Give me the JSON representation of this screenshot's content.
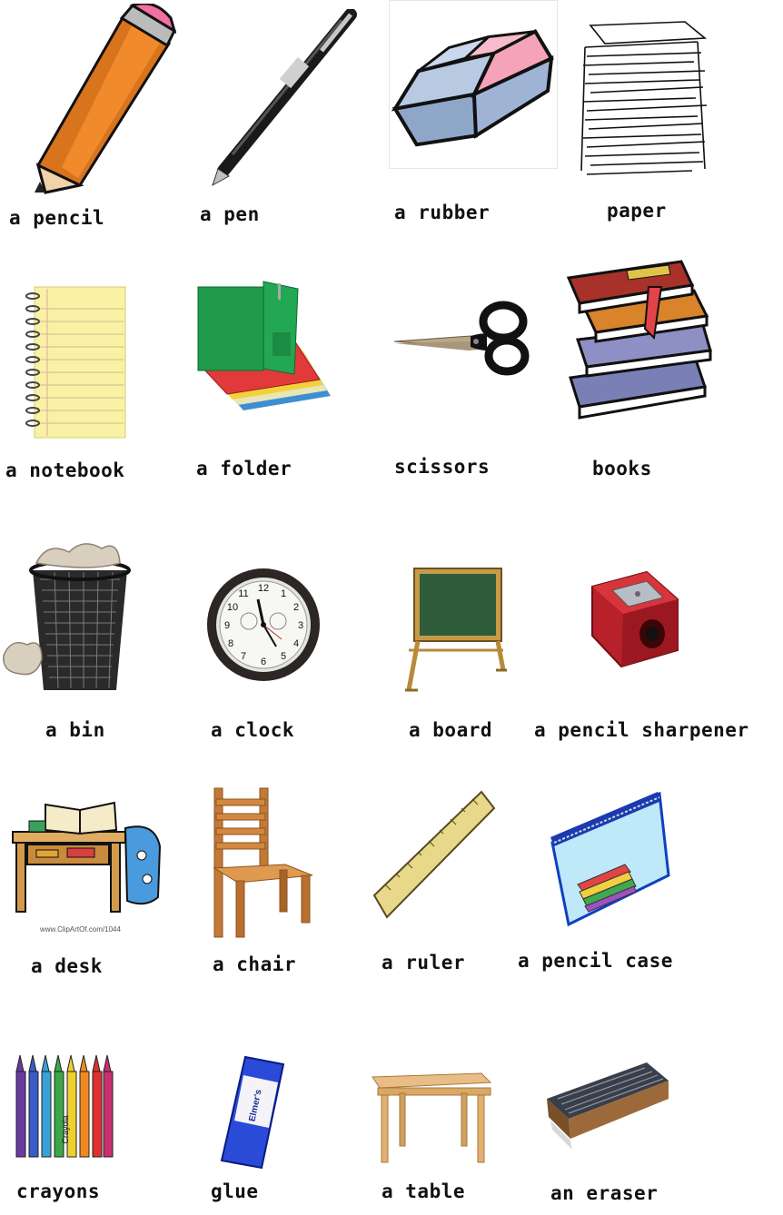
{
  "items": [
    {
      "label": "a pencil"
    },
    {
      "label": "a pen"
    },
    {
      "label": "a rubber"
    },
    {
      "label": "paper"
    },
    {
      "label": "a notebook"
    },
    {
      "label": "a folder"
    },
    {
      "label": "scissors"
    },
    {
      "label": "books"
    },
    {
      "label": "a bin"
    },
    {
      "label": "a clock"
    },
    {
      "label": "a board"
    },
    {
      "label": "a pencil sharpener"
    },
    {
      "label": "a desk"
    },
    {
      "label": "a chair"
    },
    {
      "label": "a ruler"
    },
    {
      "label": "a pencil case"
    },
    {
      "label": "crayons"
    },
    {
      "label": "glue"
    },
    {
      "label": "a table"
    },
    {
      "label": "an eraser"
    }
  ],
  "decor_text": {
    "desk_credit": "www.ClipArtOf.com/1044",
    "glue_brand": "Elmer's",
    "crayon_brand": "Crayola",
    "clock_numerals": [
      "12",
      "1",
      "2",
      "3",
      "4",
      "5",
      "6",
      "7",
      "8",
      "9",
      "10",
      "11"
    ]
  }
}
